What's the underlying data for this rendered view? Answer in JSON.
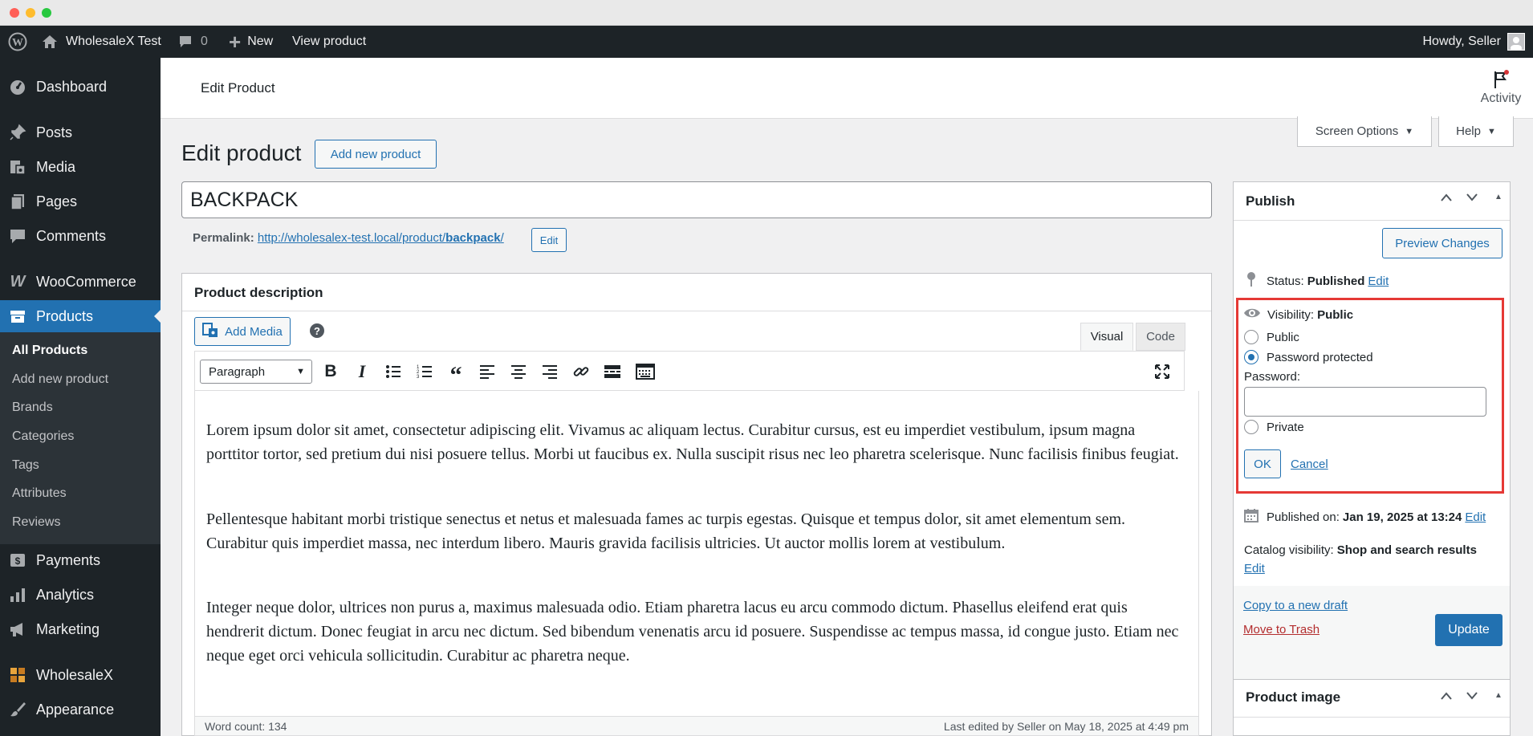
{
  "admin_bar": {
    "site_name": "WholesaleX Test",
    "comments_count": "0",
    "new_label": "New",
    "view_label": "View product",
    "greeting": "Howdy, Seller"
  },
  "sidebar": {
    "items": [
      {
        "label": "Dashboard",
        "icon": "dashboard-icon"
      },
      {
        "label": "Posts",
        "icon": "pin-icon"
      },
      {
        "label": "Media",
        "icon": "media-icon"
      },
      {
        "label": "Pages",
        "icon": "pages-icon"
      },
      {
        "label": "Comments",
        "icon": "comment-icon"
      },
      {
        "label": "WooCommerce",
        "icon": "woocommerce-icon"
      },
      {
        "label": "Products",
        "icon": "archive-icon"
      },
      {
        "label": "Payments",
        "icon": "payments-icon"
      },
      {
        "label": "Analytics",
        "icon": "bar-chart-icon"
      },
      {
        "label": "Marketing",
        "icon": "megaphone-icon"
      },
      {
        "label": "WholesaleX",
        "icon": "wholesalex-icon"
      },
      {
        "label": "Appearance",
        "icon": "brush-icon"
      }
    ],
    "submenu": [
      "All Products",
      "Add new product",
      "Brands",
      "Categories",
      "Tags",
      "Attributes",
      "Reviews"
    ]
  },
  "header": {
    "title": "Edit Product",
    "activity_label": "Activity",
    "screen_options_label": "Screen Options",
    "help_label": "Help"
  },
  "page": {
    "title": "Edit product",
    "add_new_label": "Add new product",
    "product_title": "BACKPACK",
    "permalink_label": "Permalink:",
    "permalink_base": "http://wholesalex-test.local/product/",
    "permalink_slug": "backpack",
    "permalink_trailing": "/",
    "permalink_edit": "Edit"
  },
  "description": {
    "heading": "Product description",
    "add_media_label": "Add Media",
    "help_glyph": "?",
    "tab_visual": "Visual",
    "tab_code": "Code",
    "format_select": "Paragraph",
    "paragraphs": [
      "Lorem ipsum dolor sit amet, consectetur adipiscing elit. Vivamus ac aliquam lectus. Curabitur cursus, est eu imperdiet vestibulum, ipsum magna porttitor tortor, sed pretium dui nisi posuere tellus. Morbi ut faucibus ex. Nulla suscipit risus nec leo pharetra scelerisque. Nunc facilisis finibus feugiat.",
      "Pellentesque habitant morbi tristique senectus et netus et malesuada fames ac turpis egestas. Quisque et tempus dolor, sit amet elementum sem. Curabitur quis imperdiet massa, nec interdum libero. Mauris gravida facilisis ultricies. Ut auctor mollis lorem at vestibulum.",
      "Integer neque dolor, ultrices non purus a, maximus malesuada odio. Etiam pharetra lacus eu arcu commodo dictum. Phasellus eleifend erat quis hendrerit dictum. Donec feugiat in arcu nec dictum. Sed bibendum venenatis arcu id posuere. Suspendisse ac tempus massa, id congue justo. Etiam nec neque eget orci vehicula sollicitudin. Curabitur ac pharetra neque."
    ],
    "word_count": "Word count: 134",
    "last_edited": "Last edited by Seller on May 18, 2025 at 4:49 pm"
  },
  "publish": {
    "heading": "Publish",
    "preview_label": "Preview Changes",
    "status_label": "Status:",
    "status_value": "Published",
    "edit_label": "Edit",
    "visibility_label": "Visibility:",
    "visibility_value": "Public",
    "options": [
      "Public",
      "Password protected",
      "Private"
    ],
    "selected_option": "Password protected",
    "password_label": "Password:",
    "password_value": "",
    "ok_label": "OK",
    "cancel_label": "Cancel",
    "published_on_label": "Published on:",
    "published_on_value": "Jan 19, 2025 at 13:24",
    "catalog_label": "Catalog visibility:",
    "catalog_value": "Shop and search results",
    "copy_draft_label": "Copy to a new draft",
    "trash_label": "Move to Trash",
    "update_label": "Update"
  },
  "product_image": {
    "heading": "Product image"
  },
  "colors": {
    "accent": "#2271b1",
    "admin_dark": "#1d2327",
    "highlight": "#e53935",
    "trash": "#b32d2e"
  }
}
